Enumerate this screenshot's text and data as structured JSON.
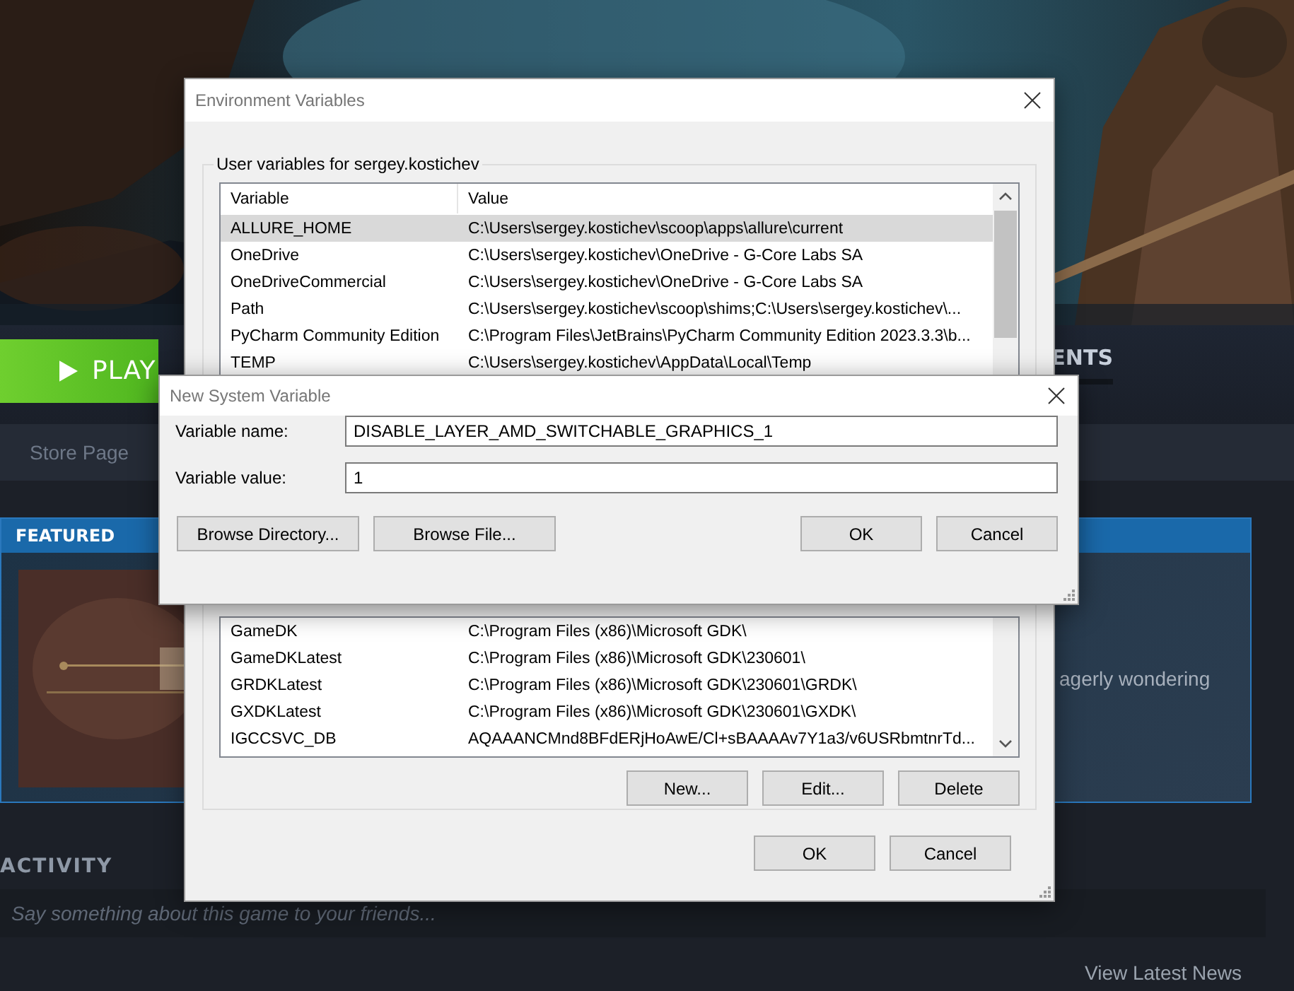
{
  "steam": {
    "play_button": "PLAY",
    "tab": {
      "label": "ENTS",
      "selected": true
    },
    "store_link": "Store Page",
    "featured": {
      "header": "FEATURED",
      "text": "agerly wondering"
    },
    "activity": {
      "heading": "ACTIVITY",
      "placeholder": "Say something about this game to your friends..."
    },
    "news_link": "View Latest News"
  },
  "env_dialog": {
    "title": "Environment Variables",
    "group_label": "User variables for sergey.kostichev",
    "columns": [
      "Variable",
      "Value"
    ],
    "user_rows": [
      {
        "name": "ALLURE_HOME",
        "value": "C:\\Users\\sergey.kostichev\\scoop\\apps\\allure\\current",
        "selected": true
      },
      {
        "name": "OneDrive",
        "value": "C:\\Users\\sergey.kostichev\\OneDrive - G-Core Labs SA",
        "selected": false
      },
      {
        "name": "OneDriveCommercial",
        "value": "C:\\Users\\sergey.kostichev\\OneDrive - G-Core Labs SA",
        "selected": false
      },
      {
        "name": "Path",
        "value": "C:\\Users\\sergey.kostichev\\scoop\\shims;C:\\Users\\sergey.kostichev\\...",
        "selected": false
      },
      {
        "name": "PyCharm Community Edition",
        "value": "C:\\Program Files\\JetBrains\\PyCharm Community Edition 2023.3.3\\b...",
        "selected": false
      },
      {
        "name": "TEMP",
        "value": "C:\\Users\\sergey.kostichev\\AppData\\Local\\Temp",
        "selected": false
      }
    ],
    "system_rows": [
      {
        "name": "GameDK",
        "value": "C:\\Program Files (x86)\\Microsoft GDK\\",
        "selected": false
      },
      {
        "name": "GameDKLatest",
        "value": "C:\\Program Files (x86)\\Microsoft GDK\\230601\\",
        "selected": false
      },
      {
        "name": "GRDKLatest",
        "value": "C:\\Program Files (x86)\\Microsoft GDK\\230601\\GRDK\\",
        "selected": false
      },
      {
        "name": "GXDKLatest",
        "value": "C:\\Program Files (x86)\\Microsoft GDK\\230601\\GXDK\\",
        "selected": false
      },
      {
        "name": "IGCCSVC_DB",
        "value": "AQAAANCMnd8BFdERjHoAwE/Cl+sBAAAAv7Y1a3/v6USRbmtnrTd...",
        "selected": false
      }
    ],
    "system_buttons": [
      "New...",
      "Edit...",
      "Delete"
    ],
    "buttons": [
      "OK",
      "Cancel"
    ]
  },
  "new_dialog": {
    "title": "New System Variable",
    "fields": [
      {
        "label": "Variable name:",
        "value": "DISABLE_LAYER_AMD_SWITCHABLE_GRAPHICS_1"
      },
      {
        "label": "Variable value:",
        "value": "1"
      }
    ],
    "left_buttons": [
      "Browse Directory...",
      "Browse File..."
    ],
    "right_buttons": [
      "OK",
      "Cancel"
    ]
  }
}
